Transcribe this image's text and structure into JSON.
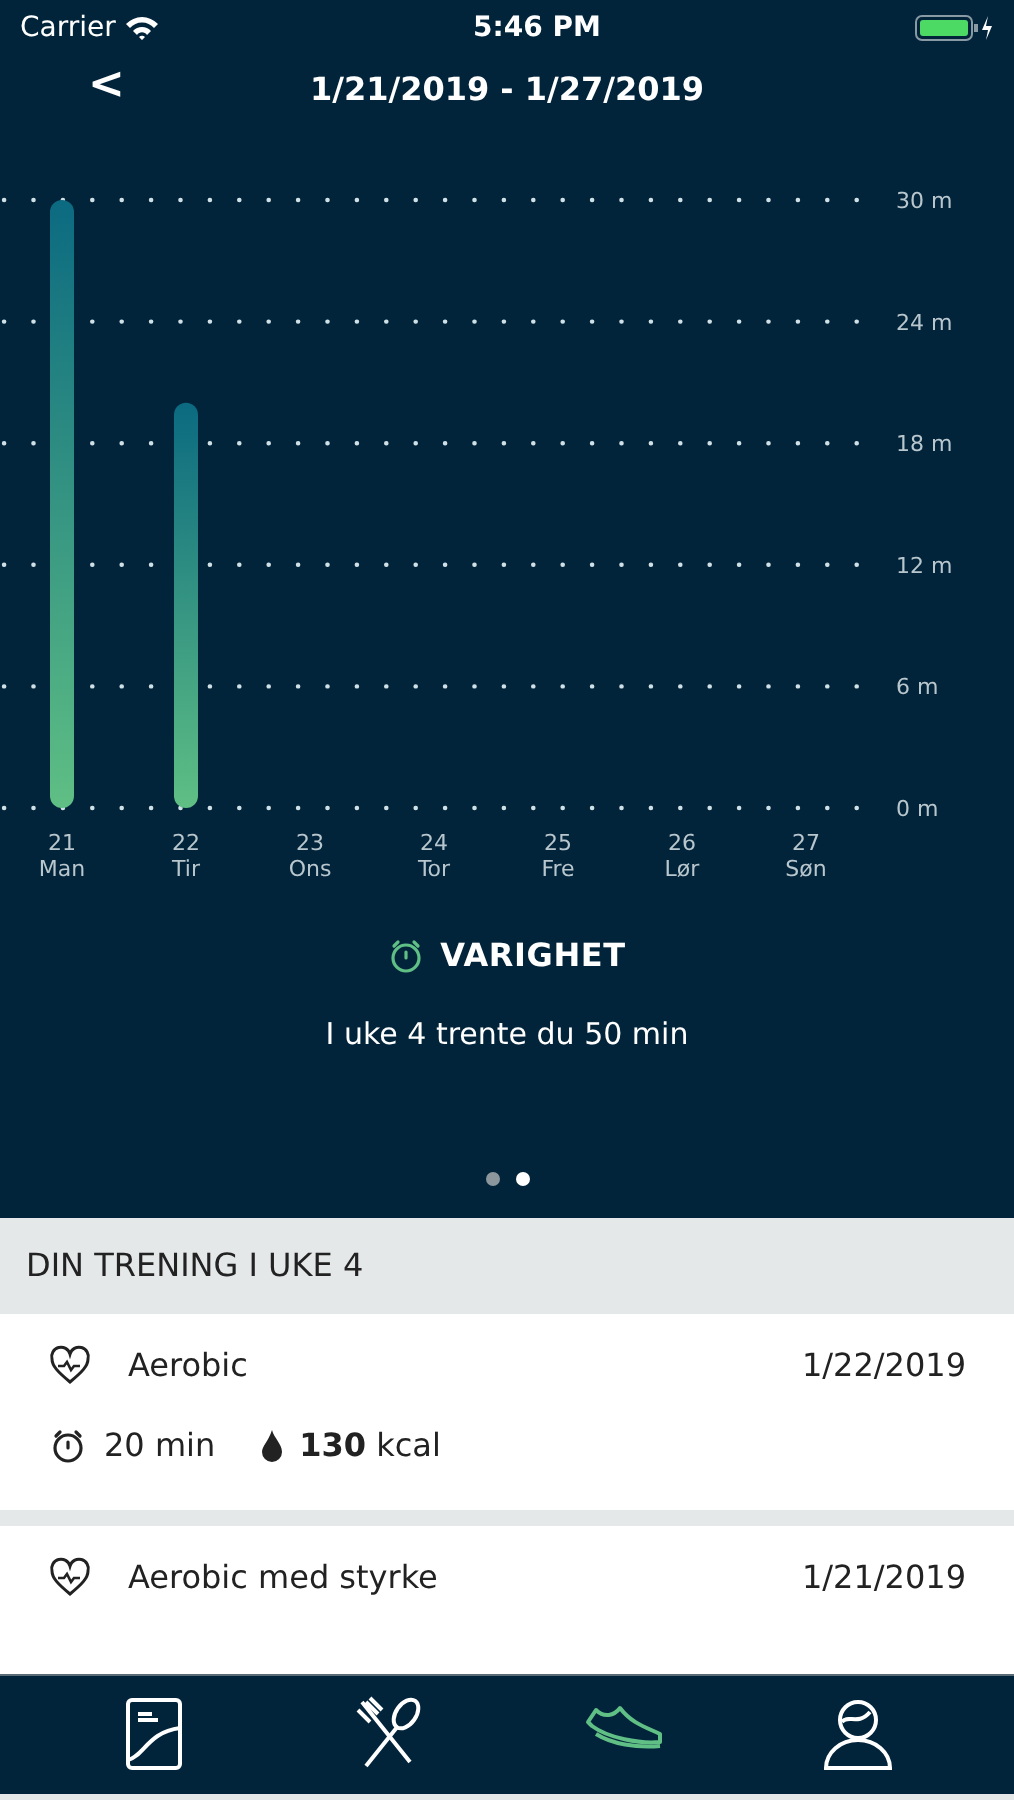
{
  "status_bar": {
    "carrier": "Carrier",
    "time": "5:46 PM"
  },
  "nav": {
    "back": "<",
    "title": "1/21/2019 - 1/27/2019"
  },
  "chart": {
    "chart_data": {
      "type": "bar",
      "categories": [
        "21\nMan",
        "22\nTir",
        "23\nOns",
        "24\nTor",
        "25\nFre",
        "26\nLør",
        "27\nSøn"
      ],
      "grid": true,
      "series": [
        {
          "color": "#5fbf84",
          "values": [
            30,
            20,
            0,
            0,
            0,
            0,
            0
          ]
        }
      ],
      "ylim": [
        0,
        30
      ],
      "yticks": [
        {
          "value": 0,
          "label": "0 m"
        },
        {
          "value": 6,
          "label": "6 m"
        },
        {
          "value": 12,
          "label": "12 m"
        },
        {
          "value": 18,
          "label": "18 m"
        },
        {
          "value": 24,
          "label": "24 m"
        },
        {
          "value": 30,
          "label": "30 m"
        }
      ]
    }
  },
  "metric": {
    "title": "VARIGHET",
    "summary": "I uke 4 trente du 50 min"
  },
  "pages": [
    {
      "selected": false
    },
    {
      "selected": true
    }
  ],
  "section_header": "DIN TRENING I UKE  4",
  "workouts": [
    {
      "name": "Aerobic",
      "date": "1/22/2019",
      "duration": "20 min",
      "calories": "**130** kcal"
    },
    {
      "name": "Aerobic med styrke",
      "date": "1/21/2019"
    }
  ],
  "tabs": [
    {
      "kind": "journal",
      "selected": false
    },
    {
      "kind": "food",
      "selected": false
    },
    {
      "kind": "shoe",
      "selected": true
    },
    {
      "kind": "profile",
      "selected": false
    }
  ]
}
